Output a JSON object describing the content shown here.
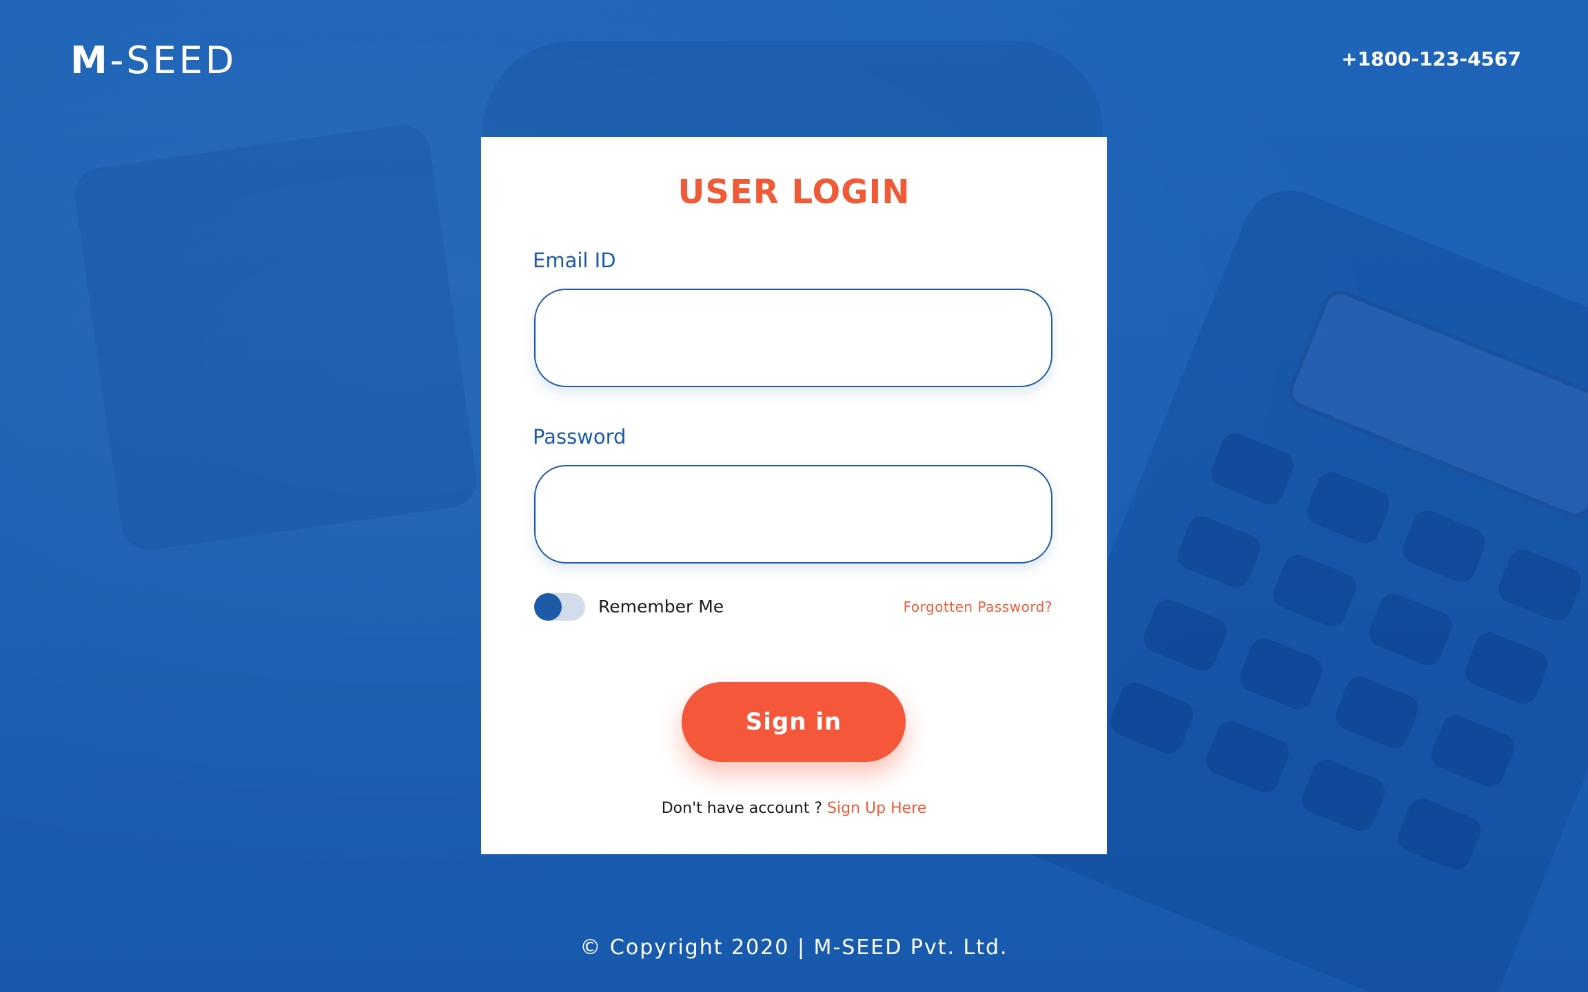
{
  "header": {
    "logo_bold": "M",
    "logo_light": "-SEED",
    "phone": "+1800-123-4567"
  },
  "login": {
    "title": "USER LOGIN",
    "email_label": "Email ID",
    "email_value": "",
    "password_label": "Password",
    "password_value": "",
    "remember_label": "Remember Me",
    "remember_checked": true,
    "forgot_link": "Forgotten Password?",
    "signin_label": "Sign in",
    "signup_prompt": "Don't have account ? ",
    "signup_link": "Sign Up Here"
  },
  "footer": {
    "copyright": "© Copyright 2020 | M-SEED Pvt. Ltd."
  },
  "colors": {
    "background": "#1a5fb4",
    "accent": "#f5573a",
    "primary": "#1d5ba9"
  }
}
